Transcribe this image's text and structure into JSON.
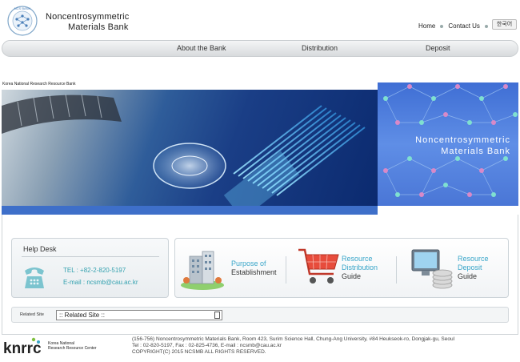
{
  "header": {
    "logo_ring_text": "NCS BANK",
    "logo_title_line1": "Noncentrosymmetric",
    "logo_title_line2": "Materials Bank",
    "links": {
      "home": "Home",
      "contact": "Contact Us"
    },
    "lang_button": "한국어"
  },
  "nav": {
    "items": [
      "About the Bank",
      "Distribution",
      "Deposit"
    ]
  },
  "hero": {
    "org_label": "Korea National Research Resource Bank",
    "banner_title_line1": "Noncentrosymmetric",
    "banner_title_line2": "Materials Bank"
  },
  "helpdesk": {
    "title": "Help Desk",
    "tel": "TEL : +82-2-820-5197",
    "email": "E-mail : ncsmb@cau.ac.kr"
  },
  "guides": [
    {
      "line1": "Purpose of",
      "line2": "Establishment",
      "icon": "building-icon"
    },
    {
      "line1": "Resource",
      "line2": "Distribution",
      "line3": "Guide",
      "icon": "shopping-cart-icon"
    },
    {
      "line1": "Resource",
      "line2": "Deposit",
      "line3": "Guide",
      "icon": "computer-coins-icon"
    }
  ],
  "related": {
    "label": "Related Site",
    "selected": ":: Related Site ::"
  },
  "footer": {
    "org_logo": "knrrc",
    "org_line1": "Korea National",
    "org_line2": "Research Resource Center",
    "address": "(156-756) Noncentrosymmetric Materials Bank, Room 423, Surim Science Hall, Chung-Ang University, #84 Heukseok-ro, Dongjak-gu, Seoul",
    "contact": "Tel : 02-820-5197, Fax : 02-825-4736, E-mail : ncsmb@cau.ac.kr",
    "copyright": "COPYRIGHT(C) 2015 NCSMB ALL RIGHTS RESERVED."
  },
  "colors": {
    "accent_teal": "#36a2b0",
    "accent_blue": "#3aa6c9",
    "banner_blue": "#3e6fc9"
  }
}
